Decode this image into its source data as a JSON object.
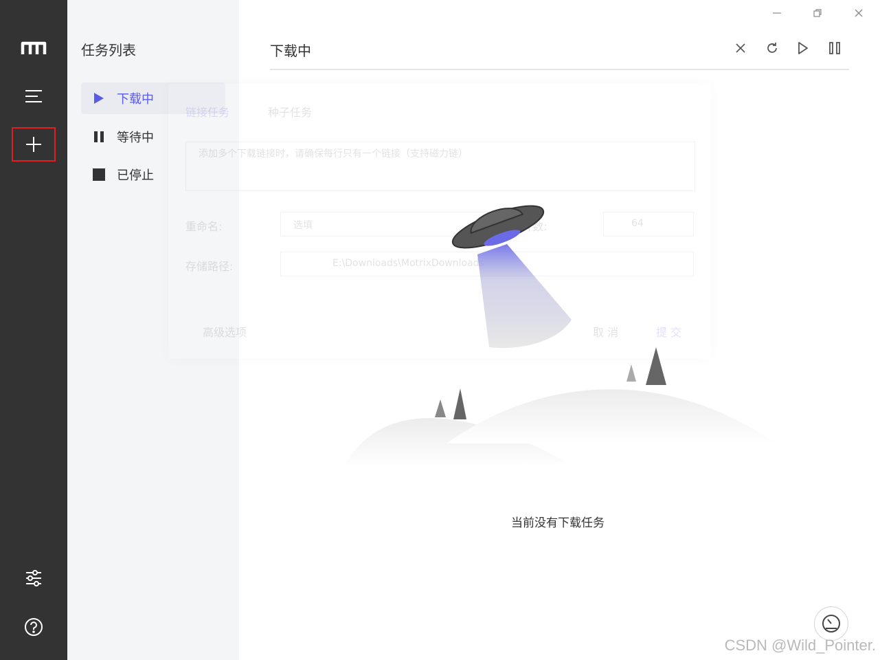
{
  "sidebar": {
    "items": [
      {
        "icon": "motrix-logo-icon"
      },
      {
        "icon": "menu-icon"
      },
      {
        "icon": "add-task-icon"
      },
      {
        "icon": "preferences-icon"
      },
      {
        "icon": "help-icon"
      }
    ]
  },
  "tasklist": {
    "title": "任务列表",
    "items": [
      {
        "label": "下载中",
        "icon": "play-icon",
        "active": true
      },
      {
        "label": "等待中",
        "icon": "pause-icon"
      },
      {
        "label": "已停止",
        "icon": "stop-icon"
      }
    ]
  },
  "header": {
    "title": "下载中",
    "actions": [
      "close-icon",
      "refresh-icon",
      "resume-all-icon",
      "pause-all-icon"
    ]
  },
  "window": {
    "controls": [
      "minimize-icon",
      "restore-icon",
      "close-window-icon"
    ]
  },
  "ghost_dialog": {
    "tabs": [
      "链接任务",
      "种子任务"
    ],
    "placeholder": "添加多个下载链接时，请确保每行只有一个链接（支持磁力链）",
    "rename_label": "重命名:",
    "rename_placeholder": "选填",
    "split_label": "分片数:",
    "split_value": "64",
    "dir_label": "存储路径:",
    "dir_value": "E:\\Downloads\\MotrixDownloads",
    "advanced_label": "高级选项",
    "cancel_label": "取 消",
    "submit_label": "提 交"
  },
  "empty": {
    "message": "当前没有下载任务"
  },
  "watermark": "CSDN @Wild_Pointer.",
  "colors": {
    "rail": "#333333",
    "accent": "#5b5bea",
    "tasklist_bg": "#f4f5f7"
  }
}
